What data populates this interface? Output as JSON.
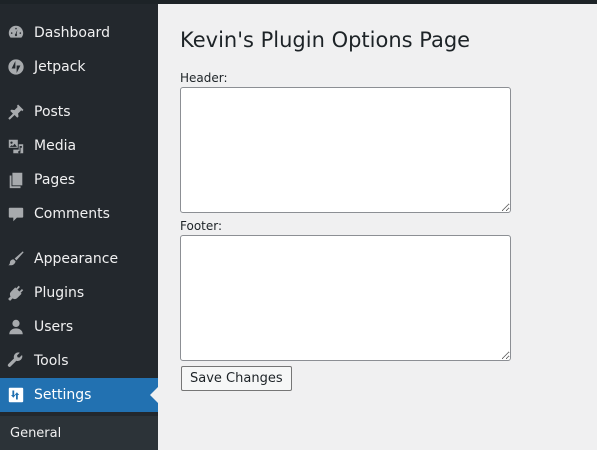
{
  "sidebar": {
    "items": [
      {
        "label": "Dashboard",
        "icon": "dashboard-icon"
      },
      {
        "label": "Jetpack",
        "icon": "jetpack-icon"
      },
      {
        "label": "Posts",
        "icon": "pin-icon"
      },
      {
        "label": "Media",
        "icon": "media-icon"
      },
      {
        "label": "Pages",
        "icon": "pages-icon"
      },
      {
        "label": "Comments",
        "icon": "comment-icon"
      },
      {
        "label": "Appearance",
        "icon": "brush-icon"
      },
      {
        "label": "Plugins",
        "icon": "plug-icon"
      },
      {
        "label": "Users",
        "icon": "user-icon"
      },
      {
        "label": "Tools",
        "icon": "wrench-icon"
      },
      {
        "label": "Settings",
        "icon": "settings-icon",
        "active": true
      }
    ],
    "submenu": {
      "label": "General"
    },
    "colors": {
      "background": "#23282d",
      "active": "#2271b1"
    }
  },
  "main": {
    "title": "Kevin's Plugin Options Page",
    "header_label": "Header:",
    "header_value": "",
    "footer_label": "Footer:",
    "footer_value": "",
    "save_label": "Save Changes"
  }
}
